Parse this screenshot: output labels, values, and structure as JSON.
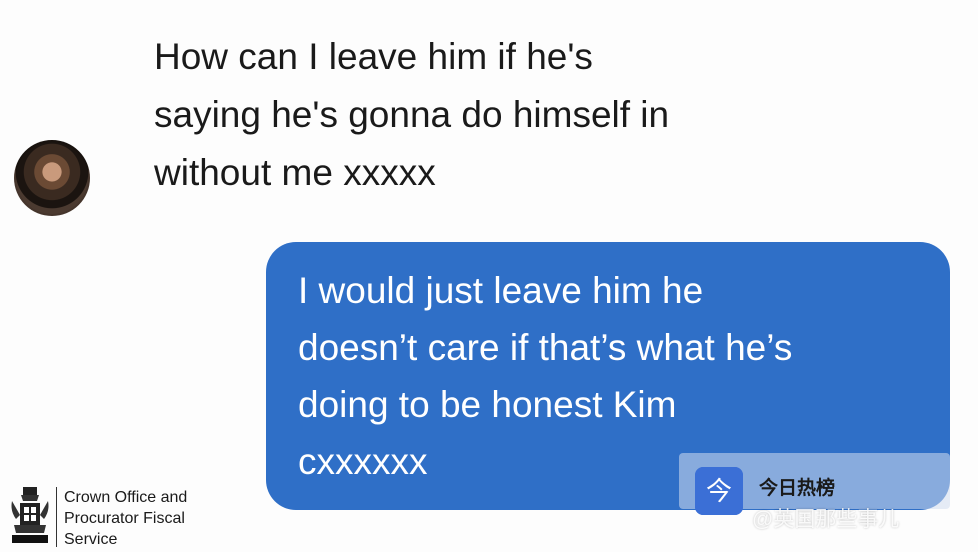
{
  "conversation": {
    "incoming_message": "How can I leave him if he's\nsaying he's gonna do himself in\nwithout me xxxxx",
    "outgoing_message": "I would just leave him he\ndoesn’t care if that’s what he’s\ndoing to be honest Kim\ncxxxxxx",
    "outgoing_bubble_color": "#2f6fc7"
  },
  "footer": {
    "organization": "Crown Office and\nProcurator Fiscal\nService"
  },
  "watermark": {
    "app_name": "今日热榜",
    "account": "@英国那些事儿"
  }
}
